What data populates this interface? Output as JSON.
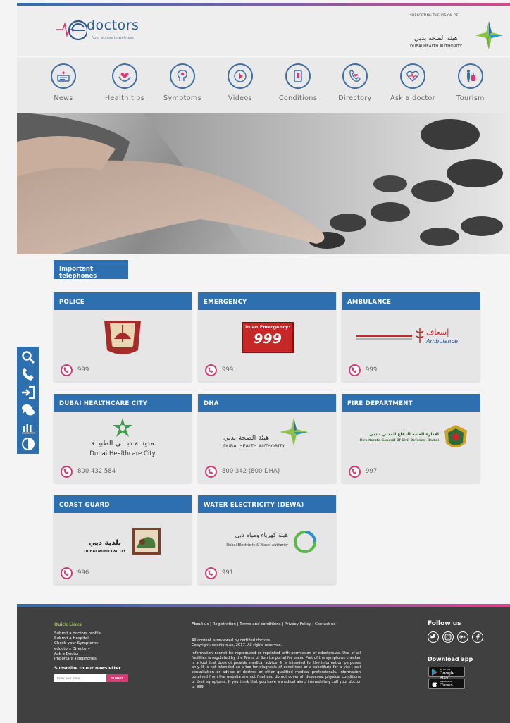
{
  "brand": {
    "name": "doctors",
    "tagline": "Your access to wellness",
    "supporting": "SUPPORTING THE VISION OF",
    "dha_ar": "هيئة الصحة بدبي",
    "dha_en": "DUBAI HEALTH AUTHORITY"
  },
  "nav": [
    {
      "label": "News",
      "icon": "news-icon"
    },
    {
      "label": "Health tips",
      "icon": "health-tips-icon"
    },
    {
      "label": "Symptoms",
      "icon": "symptoms-icon"
    },
    {
      "label": "Videos",
      "icon": "videos-icon"
    },
    {
      "label": "Conditions",
      "icon": "conditions-icon"
    },
    {
      "label": "Directory",
      "icon": "directory-icon"
    },
    {
      "label": "Ask a doctor",
      "icon": "ask-doctor-icon"
    },
    {
      "label": "Tourism",
      "icon": "tourism-icon"
    }
  ],
  "section_title": "Important telephones",
  "cards": [
    {
      "title": "POLICE",
      "phone": "999"
    },
    {
      "title": "EMERGENCY",
      "phone": "999",
      "logo_line1": "In an Emergency:",
      "logo_line2": "999"
    },
    {
      "title": "AMBULANCE",
      "phone": "999",
      "logo_ar": "إسعاف",
      "logo_en": "Ambulance"
    },
    {
      "title": "DUBAI HEALTHCARE CITY",
      "phone": "800 432 584",
      "logo_ar": "مدينــة دبـــي الطبيــة",
      "logo_en": "Dubai Healthcare City"
    },
    {
      "title": "DHA",
      "phone": "800 342 (800 DHA)",
      "logo_ar": "هيئة الصحة بدبي",
      "logo_en": "DUBAI HEALTH AUTHORITY"
    },
    {
      "title": "FIRE DEPARTMENT",
      "phone": "997",
      "logo_ar": "الإدارة العامة للدفاع المدني - دبي",
      "logo_en": "Directorate General Of Civil Defence - Dubai"
    },
    {
      "title": "COAST GUARD",
      "phone": "996",
      "logo_ar": "بلدية دبي",
      "logo_en": "DUBAI MUNICIPALITY"
    },
    {
      "title": "WATER ELECTRICITY (DEWA)",
      "phone": "991",
      "logo_ar": "هيئة كهرباء ومياه دبي",
      "logo_en": "Dubai Electricity & Water Authority"
    }
  ],
  "sidebar": [
    "search-icon",
    "phone-icon",
    "login-icon",
    "chat-icon",
    "chart-icon",
    "contrast-icon"
  ],
  "footer": {
    "quick_links_title": "Quick Links",
    "quick_links": [
      "Submit a doctors profile",
      "Submit a Hospital",
      "Check your Symptoms",
      "edoctors Directory",
      "Ask a Doctor",
      "Important Telephones"
    ],
    "newsletter_title": "Subscribe to our newsletter",
    "newsletter_placeholder": "Enter your email",
    "newsletter_button": "SUBMIT",
    "links": [
      "About us",
      "Registration",
      "Terms and conditions",
      "Privacy Policy",
      "Contact us"
    ],
    "reviewed": "All content is reviewed by certified doctors.",
    "copyright": "Copyright: edoctors.ae, 2017. All rights reserved.",
    "disclaimer": "Information cannot be reproduced or reprinted with permission of edoctors.ae. Use of all facilities is regulated by the Terms of Service portal for users. Part of the symptoms checker is a tool that does ot provide medical advice. It is intended for the information perposes only. It is not intended as a too for diagnosis of conditions or a substitute for a vist , call consultation or advice of doctros or other qualified medical professionals. Information obtained from the website are not final and do not cover all deseases, physical conditions or their symptoms. If you think that you have a medical alert, immediately call your doctor or 999.",
    "follow_title": "Follow us",
    "social": [
      "twitter-icon",
      "instagram-icon",
      "google-plus-icon",
      "facebook-icon"
    ],
    "download_title": "Download app",
    "google_small": "GET IT ON",
    "google_big": "Google Play",
    "itunes_small": "Available on",
    "itunes_big": "iTunes"
  },
  "colors": {
    "primary": "#2e6fb0",
    "accent": "#d83a73",
    "footer": "#404040",
    "link_green": "#9ec33a"
  }
}
